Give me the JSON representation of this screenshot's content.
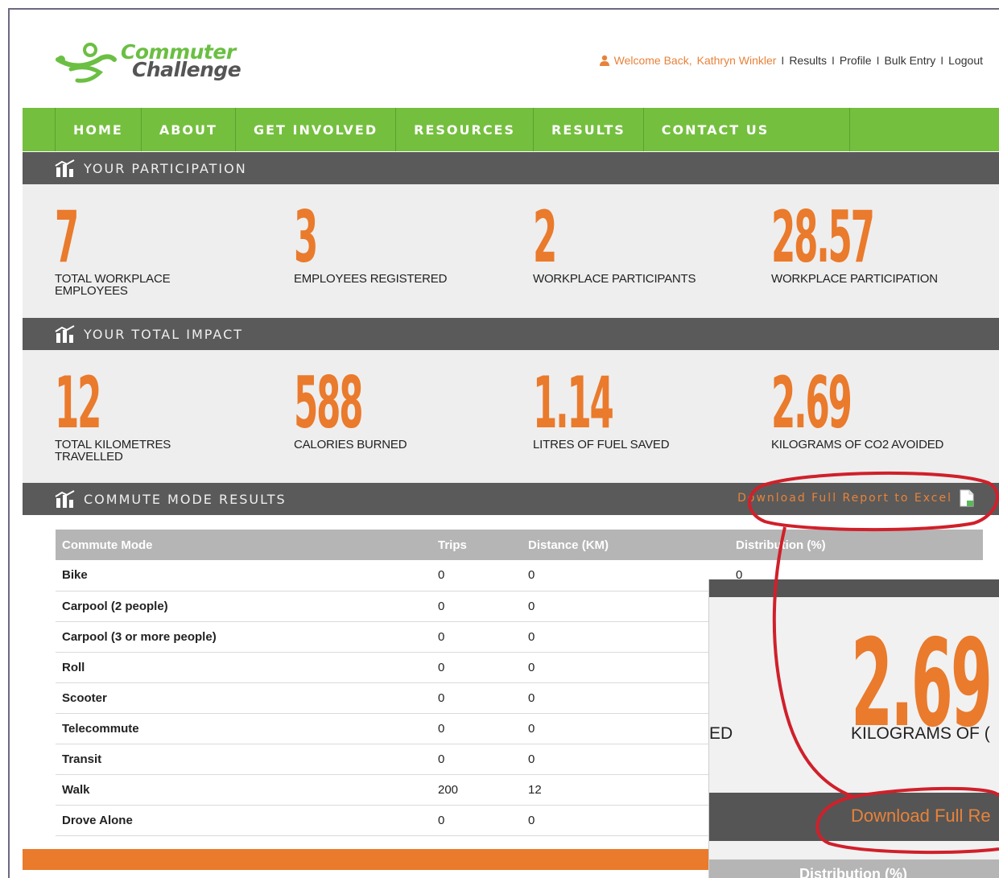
{
  "header": {
    "logo_line1": "Commuter",
    "logo_line2": "Challenge",
    "welcome": "Welcome Back,",
    "username": "Kathryn Winkler",
    "links": [
      "Results",
      "Profile",
      "Bulk Entry",
      "Logout"
    ],
    "separator": "I"
  },
  "nav": {
    "items": [
      "HOME",
      "ABOUT",
      "GET INVOLVED",
      "RESOURCES",
      "RESULTS",
      "CONTACT US"
    ]
  },
  "participation": {
    "title": "YOUR PARTICIPATION",
    "stats": [
      {
        "value": "7",
        "label": "TOTAL WORKPLACE EMPLOYEES"
      },
      {
        "value": "3",
        "label": "EMPLOYEES REGISTERED"
      },
      {
        "value": "2",
        "label": "WORKPLACE PARTICIPANTS"
      },
      {
        "value": "28.57",
        "label": "WORKPLACE PARTICIPATION"
      }
    ]
  },
  "impact": {
    "title": "YOUR TOTAL IMPACT",
    "stats": [
      {
        "value": "12",
        "label": "TOTAL KILOMETRES TRAVELLED"
      },
      {
        "value": "588",
        "label": "CALORIES BURNED"
      },
      {
        "value": "1.14",
        "label": "LITRES OF FUEL SAVED"
      },
      {
        "value": "2.69",
        "label": "KILOGRAMS OF CO2 AVOIDED"
      }
    ]
  },
  "commute": {
    "title": "COMMUTE MODE RESULTS",
    "download_label": "Download Full Report to Excel",
    "columns": [
      "Commute Mode",
      "Trips",
      "Distance (KM)",
      "Distribution (%)"
    ],
    "rows": [
      {
        "mode": "Bike",
        "trips": "0",
        "distance": "0",
        "distribution": "0"
      },
      {
        "mode": "Carpool (2 people)",
        "trips": "0",
        "distance": "0",
        "distribution": ""
      },
      {
        "mode": "Carpool (3 or more people)",
        "trips": "0",
        "distance": "0",
        "distribution": ""
      },
      {
        "mode": "Roll",
        "trips": "0",
        "distance": "0",
        "distribution": ""
      },
      {
        "mode": "Scooter",
        "trips": "0",
        "distance": "0",
        "distribution": ""
      },
      {
        "mode": "Telecommute",
        "trips": "0",
        "distance": "0",
        "distribution": ""
      },
      {
        "mode": "Transit",
        "trips": "0",
        "distance": "0",
        "distribution": ""
      },
      {
        "mode": "Walk",
        "trips": "200",
        "distance": "12",
        "distribution": ""
      },
      {
        "mode": "Drove Alone",
        "trips": "0",
        "distance": "0",
        "distribution": ""
      }
    ]
  },
  "inset": {
    "value": "2.69",
    "label": "KILOGRAMS OF (",
    "left_fragment": "ED",
    "download_fragment": "Download Full Re",
    "distribution_fragment": "Distribution (%)"
  },
  "colors": {
    "accent_orange": "#ea7a2c",
    "nav_green": "#75bf3f",
    "bar_gray": "#5a5a5a",
    "annotation_red": "#d0202a"
  }
}
